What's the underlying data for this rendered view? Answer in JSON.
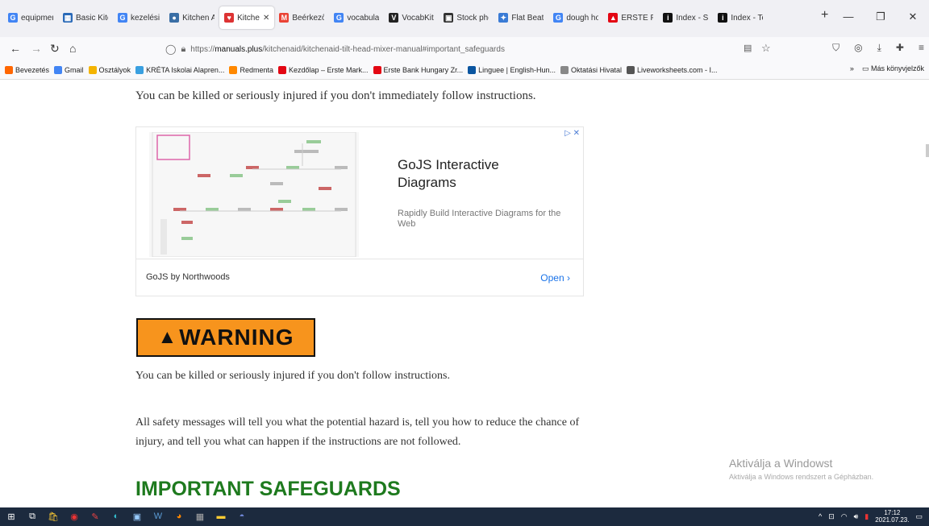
{
  "browser": {
    "tabs": [
      {
        "label": "equipmen",
        "icon": "google-icon",
        "color": "#4285f4",
        "glyph": "G"
      },
      {
        "label": "Basic Kitc",
        "icon": "kitchen-site-icon",
        "color": "#2a6ab8",
        "glyph": "▦"
      },
      {
        "label": "kezelési",
        "icon": "google-icon",
        "color": "#4285f4",
        "glyph": "G"
      },
      {
        "label": "Kitchen A",
        "icon": "kitchen-icon",
        "color": "#3a6ea5",
        "glyph": "●"
      },
      {
        "label": "Kitche",
        "icon": "manuals-plus-icon",
        "color": "#d33",
        "glyph": "♥",
        "active": true
      },
      {
        "label": "Beérkező",
        "icon": "gmail-icon",
        "color": "#ea4335",
        "glyph": "M"
      },
      {
        "label": "vocabular",
        "icon": "google-icon",
        "color": "#4285f4",
        "glyph": "G"
      },
      {
        "label": "VocabKitc",
        "icon": "vocab-icon",
        "color": "#222",
        "glyph": "V"
      },
      {
        "label": "Stock pho",
        "icon": "stock-icon",
        "color": "#333",
        "glyph": "▣"
      },
      {
        "label": "Flat Beate",
        "icon": "flat-icon",
        "color": "#3a7bd5",
        "glyph": "✦"
      },
      {
        "label": "dough ho",
        "icon": "google-icon",
        "color": "#4285f4",
        "glyph": "G"
      },
      {
        "label": "ERSTE FU",
        "icon": "erste-icon",
        "color": "#e30613",
        "glyph": "▲"
      },
      {
        "label": "Index - Sz",
        "icon": "index-icon",
        "color": "#111",
        "glyph": "i"
      },
      {
        "label": "Index - To",
        "icon": "index-icon",
        "color": "#111",
        "glyph": "i"
      }
    ],
    "url_prefix": "https://",
    "url_domain": "manuals.plus",
    "url_path": "/kitchenaid/kitchenaid-tilt-head-mixer-manual#important_safeguards",
    "bookmarks": [
      {
        "label": "Bevezetés",
        "color": "#f60"
      },
      {
        "label": "Gmail",
        "color": "#4285f4"
      },
      {
        "label": "Osztályok",
        "color": "#f4b400"
      },
      {
        "label": "KRÉTA Iskolai Alapren...",
        "color": "#3aa0e0"
      },
      {
        "label": "Redmenta",
        "color": "#f80"
      },
      {
        "label": "Kezdőlap – Erste Mark...",
        "color": "#e30613"
      },
      {
        "label": "Erste Bank Hungary Zr...",
        "color": "#e30613"
      },
      {
        "label": "Linguee | English-Hun...",
        "color": "#0a55a0"
      },
      {
        "label": "Oktatási Hivatal",
        "color": "#888"
      },
      {
        "label": "Liveworksheets.com - I...",
        "color": "#555"
      }
    ],
    "bookmarks_more": "»",
    "other_bookmarks": "Más könyvjelzők"
  },
  "page": {
    "line1": "You can be killed or seriously injured if you don't immediately follow instructions.",
    "ad": {
      "title": "GoJS Interactive Diagrams",
      "description": "Rapidly Build Interactive Diagrams for the Web",
      "brand": "GoJS by Northwoods",
      "open": "Open",
      "marker": "▷ ✕"
    },
    "warning_label": "WARNING",
    "para2": "You can be killed or seriously injured if you don't follow instructions.",
    "para3": "All safety messages will tell you what the potential hazard is, tell you how to reduce the chance of injury, and tell you what can happen if the instructions are not followed.",
    "heading": "IMPORTANT SAFEGUARDS"
  },
  "windows": {
    "activate_title": "Aktiválja a Windowst",
    "activate_sub": "Aktiválja a Windows rendszert a Gépházban.",
    "time": "17:12",
    "date": "2021.07.23."
  }
}
